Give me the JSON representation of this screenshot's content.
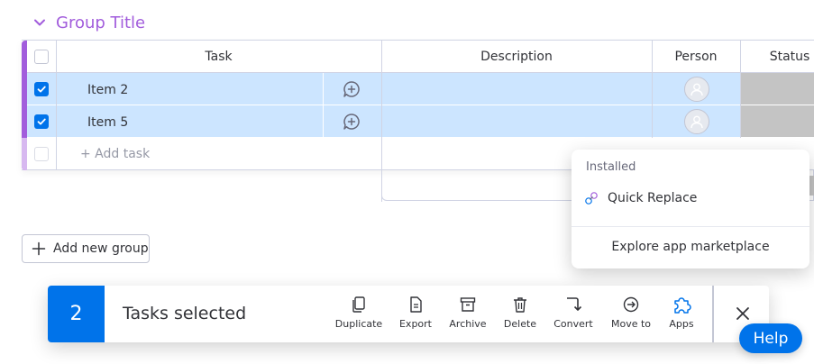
{
  "group": {
    "title": "Group Title",
    "color": "#a25ddc"
  },
  "table": {
    "columns": [
      "Task",
      "Description",
      "Person",
      "Status"
    ],
    "rows": [
      {
        "name": "Item 2",
        "selected": true
      },
      {
        "name": "Item 5",
        "selected": true
      }
    ],
    "add_task_placeholder": "+ Add task"
  },
  "add_group_label": "Add new group",
  "apps_popup": {
    "section": "Installed",
    "installed_app": "Quick Replace",
    "explore": "Explore app marketplace"
  },
  "action_bar": {
    "count": "2",
    "selected_label": "Tasks selected",
    "actions": [
      {
        "label": "Duplicate",
        "icon": "duplicate-icon"
      },
      {
        "label": "Export",
        "icon": "export-icon"
      },
      {
        "label": "Archive",
        "icon": "archive-icon"
      },
      {
        "label": "Delete",
        "icon": "trash-icon"
      },
      {
        "label": "Convert",
        "icon": "convert-icon"
      },
      {
        "label": "Move to",
        "icon": "move-to-icon"
      },
      {
        "label": "Apps",
        "icon": "apps-icon"
      }
    ]
  },
  "help_label": "Help",
  "colors": {
    "accent": "#0073ea",
    "selected_row": "#cce5ff",
    "status_empty": "#c4c4c4"
  }
}
